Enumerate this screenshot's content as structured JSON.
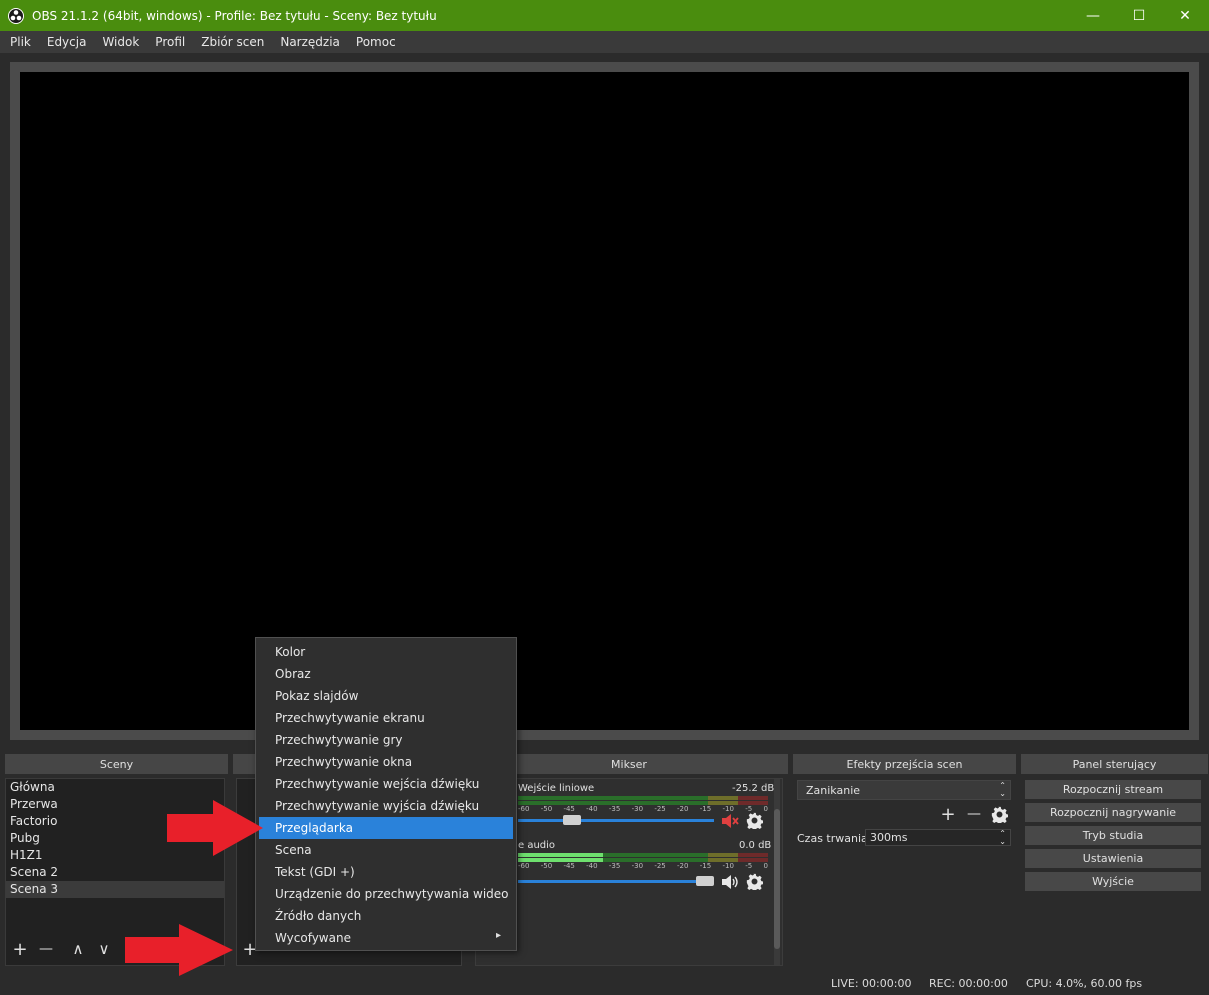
{
  "window": {
    "title": "OBS 21.1.2 (64bit, windows) - Profile: Bez tytułu - Sceny: Bez tytułu",
    "minimize_glyph": "—",
    "maximize_glyph": "☐",
    "close_glyph": "✕"
  },
  "menu": {
    "items": [
      "Plik",
      "Edycja",
      "Widok",
      "Profil",
      "Zbiór scen",
      "Narzędzia",
      "Pomoc"
    ]
  },
  "docks": {
    "scenes_title": "Sceny",
    "mixer_title": "Mikser",
    "transitions_title": "Efekty przejścia scen",
    "controls_title": "Panel sterujący"
  },
  "scenes": {
    "items": [
      "Główna",
      "Przerwa",
      "Factorio",
      "Pubg",
      "H1Z1",
      "Scena 2",
      "Scena 3"
    ],
    "selected_index": 6
  },
  "toolbar_glyphs": {
    "add": "+",
    "remove": "—",
    "up": "∧",
    "down": "∨"
  },
  "mixer": {
    "channels": [
      {
        "name": "Wejście liniowe",
        "db": "-25.2 dB",
        "muted": true,
        "volume": 0.12
      },
      {
        "name": "e audio",
        "db": "0.0 dB",
        "muted": false,
        "volume": 1.0
      }
    ],
    "ticks": [
      "-60",
      "-50",
      "-45",
      "-40",
      "-35",
      "-30",
      "-25",
      "-20",
      "-15",
      "-10",
      "-5",
      "0"
    ]
  },
  "transitions": {
    "selected": "Zanikanie",
    "duration_label": "Czas trwania",
    "duration_value": "300ms"
  },
  "controls": {
    "buttons": [
      "Rozpocznij stream",
      "Rozpocznij nagrywanie",
      "Tryb studia",
      "Ustawienia",
      "Wyjście"
    ]
  },
  "status": {
    "live": "LIVE: 00:00:00",
    "rec": "REC: 00:00:00",
    "cpu": "CPU: 4.0%, 60.00 fps"
  },
  "context_menu": {
    "items": [
      "Kolor",
      "Obraz",
      "Pokaz slajdów",
      "Przechwytywanie ekranu",
      "Przechwytywanie gry",
      "Przechwytywanie okna",
      "Przechwytywanie wejścia dźwięku",
      "Przechwytywanie wyjścia dźwięku",
      "Przeglądarka",
      "Scena",
      "Tekst (GDI +)",
      "Urządzenie do przechwytywania wideo",
      "Źródło danych",
      "Wycofywane"
    ],
    "highlighted_index": 8,
    "submenu_glyph": "▸"
  },
  "colors": {
    "titlebar": "#4a8d0e",
    "highlight": "#2a82da",
    "arrow": "#e8202a"
  }
}
